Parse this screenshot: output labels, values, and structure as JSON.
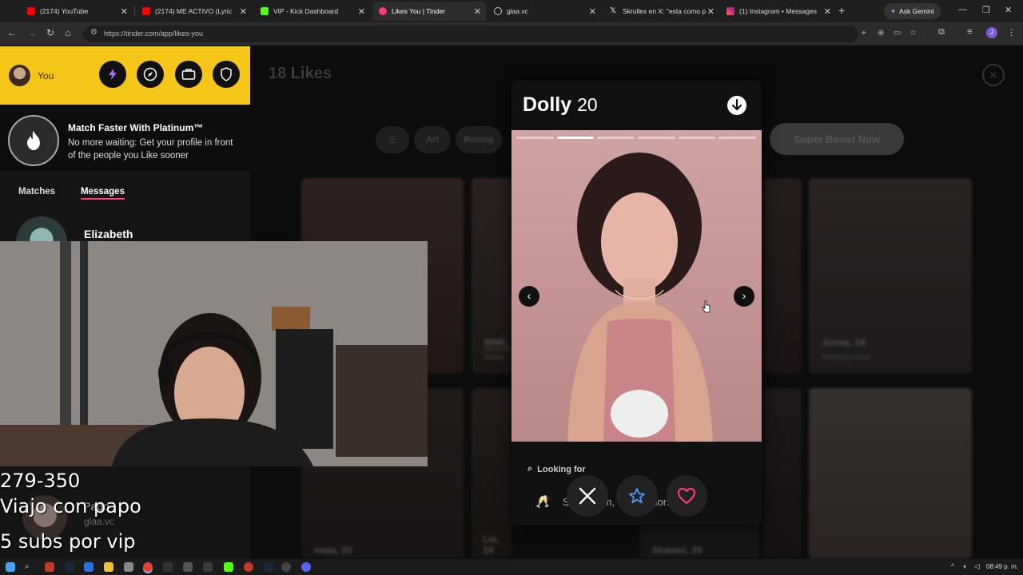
{
  "browser": {
    "tabs": [
      {
        "title": "(2174) YouTube",
        "color": "#ff0000"
      },
      {
        "title": "(2174) ME ACTIVO (Lyric",
        "color": "#ff0000"
      },
      {
        "title": "VIP - Kick Dashboard",
        "color": "#53fc18"
      },
      {
        "title": "Likes You | Tinder",
        "color": "#fe3c72"
      },
      {
        "title": "glaa.vc",
        "color": "#9aa0a6"
      },
      {
        "title": "Skrullex en X: \"esta como p",
        "color": "#ffffff"
      },
      {
        "title": "(1) Instagram • Messages",
        "color": "#e1306c"
      }
    ],
    "ask_gemini": "Ask Gemini",
    "url": "https://tinder.com/app/likes-you",
    "profile_initial": "J"
  },
  "sidebar": {
    "user_label": "You",
    "promo_title": "Match Faster With Platinum™",
    "promo_text": "No more waiting: Get your profile in front of the people you Like sooner",
    "tab_matches": "Matches",
    "tab_messages": "Messages",
    "message_name": "Elizabeth"
  },
  "main": {
    "likes_title": "18 Likes",
    "filters": [
      "Art",
      "Boxing"
    ],
    "boost_label": "Super Boost Now",
    "cards": [
      {
        "name": "RNR, ",
        "status": "Recently Active"
      },
      {
        "name": "Jenna, 19",
        "status": "Recently Active"
      },
      {
        "name": "maia, 20",
        "status": ""
      },
      {
        "name": "Lia, 19",
        "status": ""
      },
      {
        "name": "Shamei, 29",
        "status": ""
      }
    ]
  },
  "profile": {
    "name": "Dolly",
    "age": "20",
    "photo_count": 6,
    "active_photo": 2,
    "looking_for_label": "Looking for",
    "looking_for_value": "Short-term, open to long"
  },
  "overlay": {
    "line1": "279-350",
    "line2": "Viajo con papo",
    "line3": "5 subs por vip",
    "chat_name": "Papo",
    "chat_sub": "glaa.vc"
  },
  "taskbar": {
    "time": "08:49 p. m."
  }
}
